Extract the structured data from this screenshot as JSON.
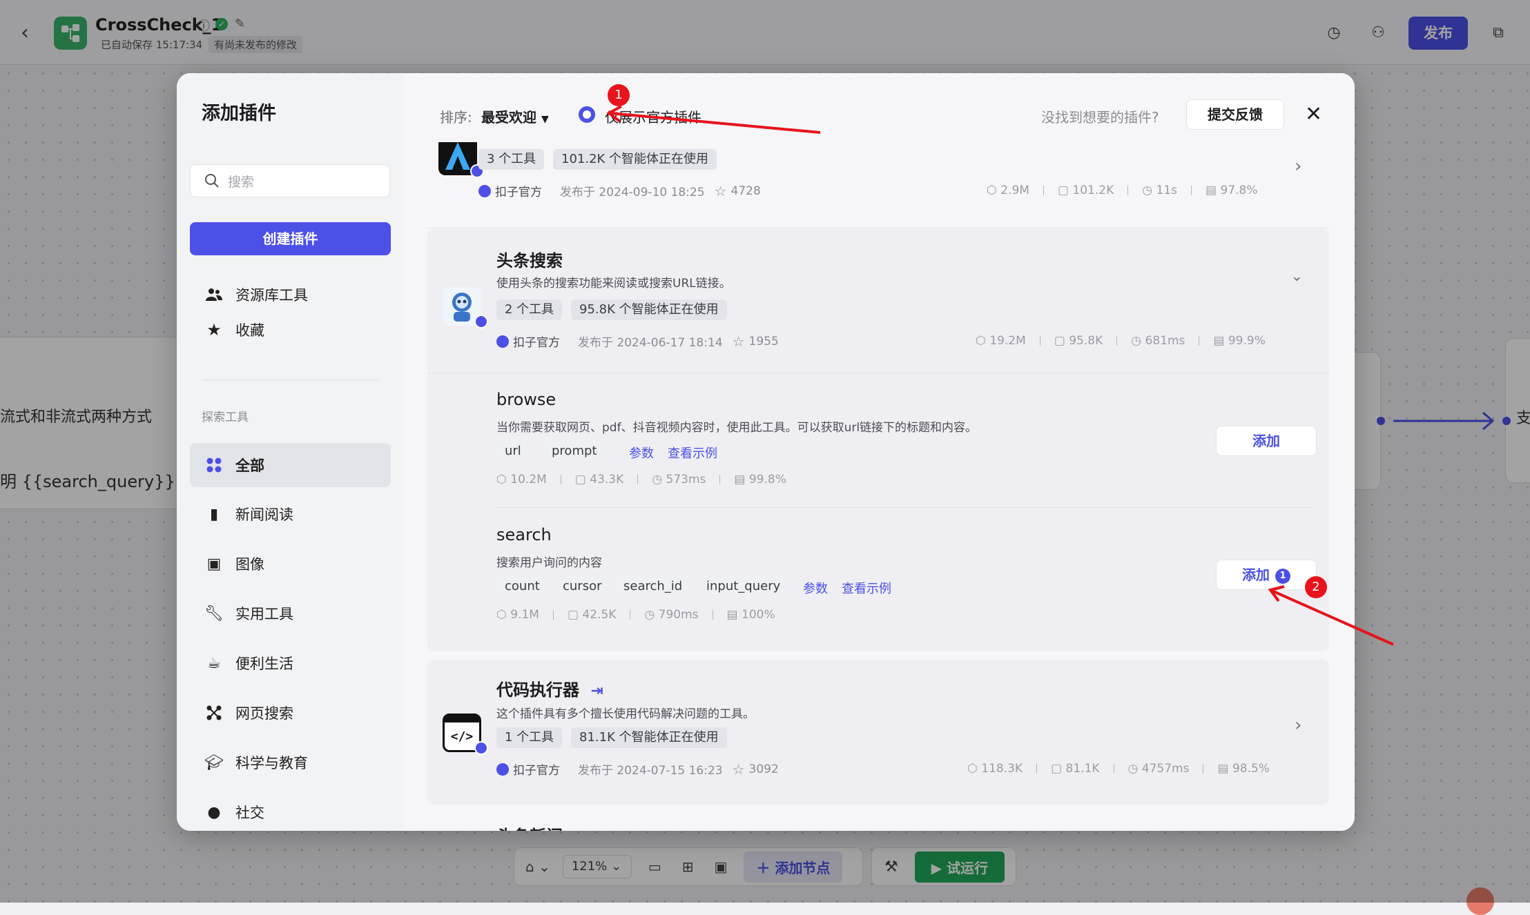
{
  "topbar": {
    "app_name": "CrossCheck_1",
    "autosave": "已自动保存 15:17:34",
    "unpublished": "有尚未发布的修改",
    "publish": "发布"
  },
  "canvas": {
    "node_text_1": "流式和非流式两种方式",
    "node_text_2": "明 {{search_query}} <-",
    "node_text_3": "支"
  },
  "bottom_toolbar": {
    "zoom": "121%",
    "add_node": "添加节点",
    "test_run": "试运行"
  },
  "modal": {
    "title": "添加插件",
    "search_placeholder": "搜索",
    "create_button": "创建插件",
    "my_items": [
      {
        "label": "资源库工具",
        "icon": "users-icon"
      },
      {
        "label": "收藏",
        "icon": "star-icon"
      }
    ],
    "explore_label": "探索工具",
    "categories": [
      {
        "label": "全部",
        "icon": "grid-icon",
        "active": true
      },
      {
        "label": "新闻阅读",
        "icon": "book-icon"
      },
      {
        "label": "图像",
        "icon": "image-icon"
      },
      {
        "label": "实用工具",
        "icon": "wrench-icon"
      },
      {
        "label": "便利生活",
        "icon": "cup-icon"
      },
      {
        "label": "网页搜索",
        "icon": "network-icon"
      },
      {
        "label": "科学与教育",
        "icon": "graduation-icon"
      },
      {
        "label": "社交",
        "icon": "chat-icon"
      }
    ],
    "sort_label": "排序:",
    "sort_value": "最受欢迎",
    "official_only": "仅展示官方插件",
    "not_found": "没找到想要的插件?",
    "feedback": "提交反馈",
    "plugins": [
      {
        "tools": "3 个工具",
        "users": "101.2K 个智能体正在使用",
        "publisher": "扣子官方",
        "published": "发布于 2024-09-10 18:25",
        "stars": "4728",
        "stats": [
          "2.9M",
          "101.2K",
          "11s",
          "97.8%"
        ]
      },
      {
        "name": "头条搜索",
        "desc": "使用头条的搜索功能来阅读或搜索URL链接。",
        "tools": "2 个工具",
        "users": "95.8K 个智能体正在使用",
        "publisher": "扣子官方",
        "published": "发布于 2024-06-17 18:14",
        "stars": "1955",
        "stats": [
          "19.2M",
          "95.8K",
          "681ms",
          "99.9%"
        ],
        "tool_list": [
          {
            "name": "browse",
            "desc": "当你需要获取网页、pdf、抖音视频内容时，使用此工具。可以获取url链接下的标题和内容。",
            "params": [
              "url",
              "prompt"
            ],
            "params_link": "参数",
            "example_link": "查看示例",
            "stats": [
              "10.2M",
              "43.3K",
              "573ms",
              "99.8%"
            ],
            "add": "添加"
          },
          {
            "name": "search",
            "desc": "搜索用户询问的内容",
            "params": [
              "count",
              "cursor",
              "search_id",
              "input_query"
            ],
            "params_link": "参数",
            "example_link": "查看示例",
            "stats": [
              "9.1M",
              "42.5K",
              "790ms",
              "100%"
            ],
            "add": "添加",
            "added_count": "1"
          }
        ]
      },
      {
        "name": "代码执行器",
        "desc": "这个插件具有多个擅长使用代码解决问题的工具。",
        "tools": "1 个工具",
        "users": "81.1K 个智能体正在使用",
        "publisher": "扣子官方",
        "published": "发布于 2024-07-15 16:23",
        "stars": "3092",
        "stats": [
          "118.3K",
          "81.1K",
          "4757ms",
          "98.5%"
        ]
      },
      {
        "name": "头条新闻"
      }
    ]
  },
  "annotations": {
    "marker_1": "1",
    "marker_2": "2",
    "arrow_color": "#e8131b"
  }
}
